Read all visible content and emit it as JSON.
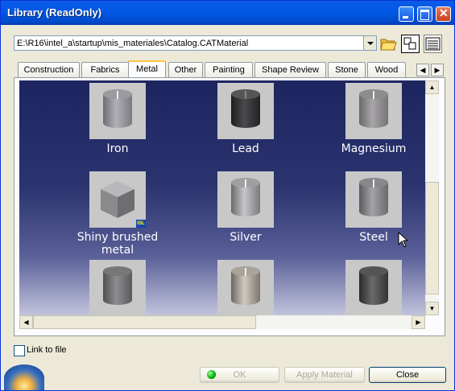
{
  "window": {
    "title": "Library (ReadOnly)"
  },
  "path": {
    "value": "E:\\R16\\intel_a\\startup\\mis_materiales\\Catalog.CATMaterial"
  },
  "tabs": [
    {
      "label": "Construction"
    },
    {
      "label": "Fabrics"
    },
    {
      "label": "Metal",
      "active": true
    },
    {
      "label": "Other"
    },
    {
      "label": "Painting"
    },
    {
      "label": "Shape Review"
    },
    {
      "label": "Stone"
    },
    {
      "label": "Wood"
    }
  ],
  "materials": [
    {
      "name": "Iron",
      "color": "#8a8a90"
    },
    {
      "name": "Lead",
      "color": "#3a3a3a"
    },
    {
      "name": "Magnesium",
      "color": "#8e8c8e"
    },
    {
      "name": "Shiny brushed metal",
      "color": "#8e8e90",
      "badge": "ISL"
    },
    {
      "name": "Silver",
      "color": "#9a9a9c"
    },
    {
      "name": "Steel",
      "color": "#7a7a7e"
    },
    {
      "name": "",
      "color": "#777"
    },
    {
      "name": "",
      "color": "#a9a39a"
    },
    {
      "name": "",
      "color": "#555"
    }
  ],
  "options": {
    "link_to_file_label": "Link to file",
    "link_to_file_checked": false
  },
  "buttons": {
    "ok": "OK",
    "apply": "Apply Material",
    "close": "Close"
  }
}
